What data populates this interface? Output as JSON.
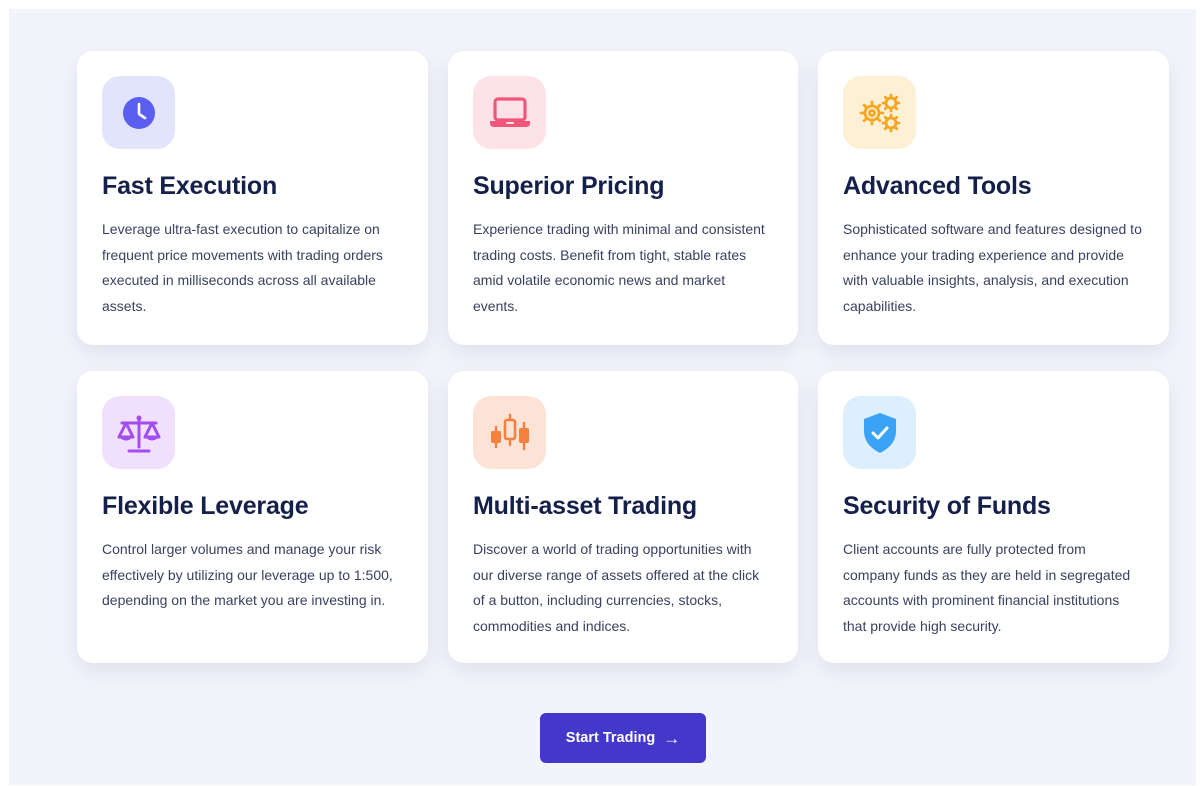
{
  "features": [
    {
      "title": "Fast Execution",
      "description": "Leverage ultra-fast execution to capitalize on frequent price movements with trading orders executed in milliseconds across all available assets.",
      "icon": "clock-icon",
      "icon_color": "#5b5ff0",
      "icon_bg": "#e2e4fb"
    },
    {
      "title": "Superior Pricing",
      "description": "Experience trading with minimal and consistent trading costs. Benefit from tight, stable rates amid volatile economic news and market events.",
      "icon": "laptop-icon",
      "icon_color": "#f0567a",
      "icon_bg": "#fde2e8"
    },
    {
      "title": "Advanced Tools",
      "description": "Sophisticated software and features designed to enhance your trading experience and provide with valuable insights, analysis, and execution capabilities.",
      "icon": "gears-icon",
      "icon_color": "#f5a623",
      "icon_bg": "#fdf0d4"
    },
    {
      "title": "Flexible Leverage",
      "description": "Control larger volumes and manage your risk effectively by utilizing our leverage up to 1:500, depending on the market you are investing in.",
      "icon": "scales-icon",
      "icon_color": "#a34cf0",
      "icon_bg": "#f1e0fd"
    },
    {
      "title": "Multi-asset Trading",
      "description": "Discover a world of trading opportunities with our diverse range of assets offered at the click of a button, including currencies, stocks, commodities and indices.",
      "icon": "candlestick-icon",
      "icon_color": "#f5813f",
      "icon_bg": "#fde3d6"
    },
    {
      "title": "Security of Funds",
      "description": "Client accounts are fully protected from company funds as they are held in segregated accounts with prominent financial institutions that provide high security.",
      "icon": "shield-check-icon",
      "icon_color": "#3ba3f5",
      "icon_bg": "#ddeefd"
    }
  ],
  "cta": {
    "label": "Start Trading",
    "icon": "arrow-right-icon",
    "color": "#4338ca"
  }
}
